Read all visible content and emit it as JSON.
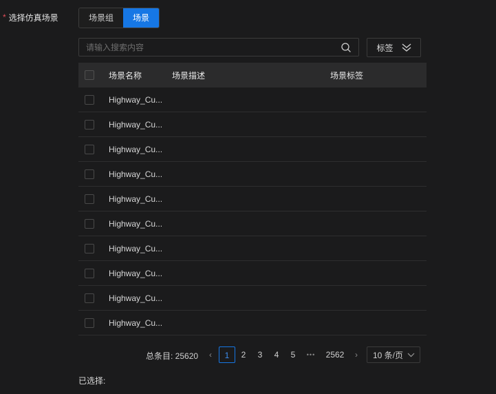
{
  "form": {
    "required_mark": "*",
    "label": "选择仿真场景"
  },
  "tabs": [
    {
      "label": "场景组",
      "active": false
    },
    {
      "label": "场景",
      "active": true
    }
  ],
  "search": {
    "placeholder": "请输入搜索内容",
    "value": "",
    "icon": "search-icon"
  },
  "tag_filter": {
    "label": "标签",
    "icon": "double-chevron-down-icon"
  },
  "table": {
    "columns": [
      "场景名称",
      "场景描述",
      "场景标签"
    ],
    "rows": [
      {
        "name": "Highway_Cu...",
        "description": "",
        "tags": ""
      },
      {
        "name": "Highway_Cu...",
        "description": "",
        "tags": ""
      },
      {
        "name": "Highway_Cu...",
        "description": "",
        "tags": ""
      },
      {
        "name": "Highway_Cu...",
        "description": "",
        "tags": ""
      },
      {
        "name": "Highway_Cu...",
        "description": "",
        "tags": ""
      },
      {
        "name": "Highway_Cu...",
        "description": "",
        "tags": ""
      },
      {
        "name": "Highway_Cu...",
        "description": "",
        "tags": ""
      },
      {
        "name": "Highway_Cu...",
        "description": "",
        "tags": ""
      },
      {
        "name": "Highway_Cu...",
        "description": "",
        "tags": ""
      },
      {
        "name": "Highway_Cu...",
        "description": "",
        "tags": ""
      }
    ]
  },
  "pagination": {
    "total_label": "总条目: 25620",
    "prev": "‹",
    "pages": [
      "1",
      "2",
      "3",
      "4",
      "5"
    ],
    "current": "1",
    "ellipsis": "•••",
    "last": "2562",
    "next": "›",
    "page_size": "10 条/页"
  },
  "selected": {
    "label": "已选择:"
  },
  "colors": {
    "accent": "#1677e5",
    "background": "#1b1b1c",
    "header_bg": "#2b2b2c",
    "required": "#e34d59"
  }
}
